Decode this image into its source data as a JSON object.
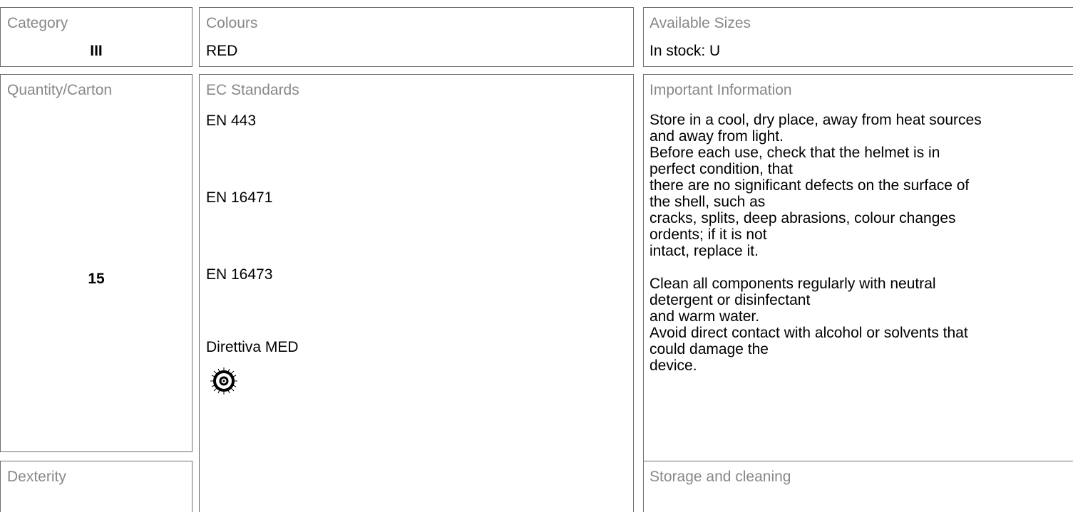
{
  "category": {
    "label": "Category",
    "value": "III"
  },
  "colours": {
    "label": "Colours",
    "value": "RED"
  },
  "sizes": {
    "label": "Available Sizes",
    "value": "In stock: U"
  },
  "quantity": {
    "label": "Quantity/Carton",
    "value": "15"
  },
  "standards": {
    "label": "EC Standards",
    "items": [
      "EN 443",
      "EN 16471",
      "EN 16473",
      "Direttiva MED"
    ],
    "icon": "wheel-mark-icon"
  },
  "important": {
    "label": "Important Information",
    "lines": [
      "Store in a cool, dry place, away from heat sources",
      "and away from light.",
      "Before each use, check that the helmet is in",
      "perfect condition, that",
      "there are no significant defects on the surface of",
      "the shell, such as",
      "cracks, splits, deep abrasions, colour changes",
      "ordents; if it is not",
      "intact, replace it.",
      "",
      "Clean all components regularly with neutral",
      "detergent or disinfectant",
      "and warm water.",
      "Avoid direct contact with alcohol or solvents that",
      "could damage the",
      "device."
    ]
  },
  "dexterity": {
    "label": "Dexterity"
  },
  "storage": {
    "label": "Storage and cleaning"
  }
}
